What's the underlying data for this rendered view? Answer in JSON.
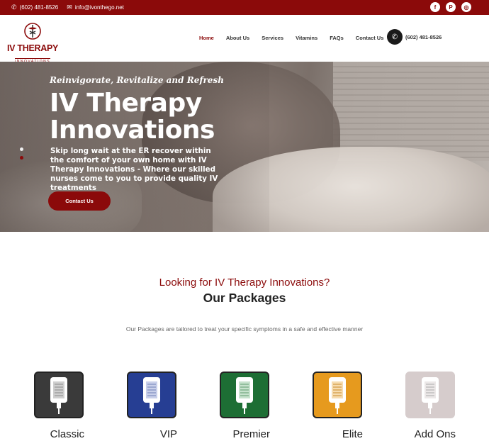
{
  "topbar": {
    "phone": "(602) 481-8526",
    "email": "info@ivonthego.net",
    "social": [
      "facebook-icon",
      "pinterest-icon",
      "instagram-icon"
    ]
  },
  "logo": {
    "line1": "IV THERAPY",
    "line2": "INNOVATIONS"
  },
  "nav": {
    "items": [
      "Home",
      "About Us",
      "Services",
      "Vitamins",
      "FAQs",
      "Contact Us"
    ],
    "active": "Home",
    "phone": "(602) 481-8526"
  },
  "hero": {
    "tagline": "Reinvigorate, Revitalize and Refresh",
    "title_line1": "IV Therapy",
    "title_line2": "Innovations",
    "description": "Skip long wait at the ER recover within the comfort of your own home with IV Therapy Innovations - Where our skilled nurses come to you to provide quality IV treatments",
    "cta": "Contact Us"
  },
  "packages": {
    "sub_heading": "Looking for IV Therapy Innovations?",
    "heading": "Our Packages",
    "intro": "Our Packages are tailored to treat your specific symptoms in a safe and effective manner",
    "items": [
      {
        "label": "Classic",
        "color": "#3a3a3a"
      },
      {
        "label": "VIP",
        "color": "#263e93"
      },
      {
        "label": "Premier",
        "color": "#1d6e34"
      },
      {
        "label": "Elite",
        "color": "#e69a1e"
      },
      {
        "label": "Add Ons",
        "color": "#d6cccc"
      }
    ]
  },
  "colors": {
    "brand": "#8b0a0a",
    "dark": "#1a1a1a"
  }
}
